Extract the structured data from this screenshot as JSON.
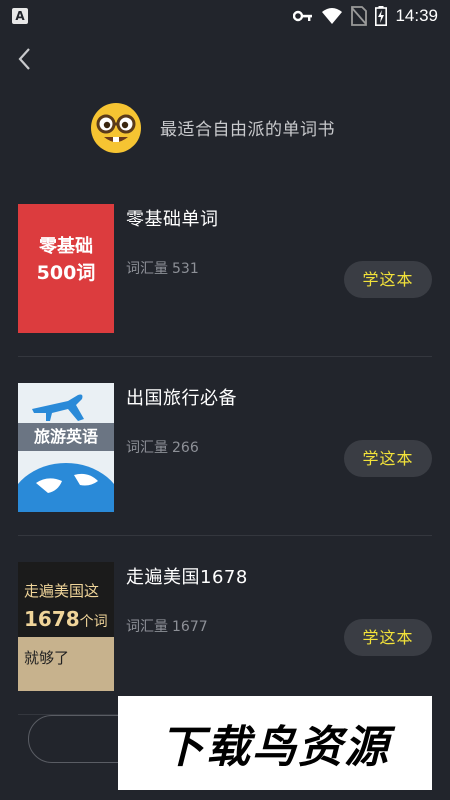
{
  "status_bar": {
    "app_icon_letter": "A",
    "time": "14:39",
    "icons": [
      "key-icon",
      "wifi-icon",
      "no-sim-icon",
      "battery-charging-icon"
    ]
  },
  "header": {
    "back_icon": "chevron-left-icon",
    "emoji": "nerd-face-emoji",
    "tagline": "最适合自由派的单词书"
  },
  "books": [
    {
      "title": "零基础单词",
      "count_label": "词汇量",
      "count": "531",
      "button_label": "学这本",
      "cover": {
        "line1": "零基础",
        "line2": "500词"
      }
    },
    {
      "title": "出国旅行必备",
      "count_label": "词汇量",
      "count": "266",
      "button_label": "学这本",
      "cover": {
        "line1": "旅游英语"
      }
    },
    {
      "title": "走遍美国1678",
      "count_label": "词汇量",
      "count": "1677",
      "button_label": "学这本",
      "cover": {
        "line1": "走遍美国这",
        "line2_num": "1678",
        "line2_unit": "个词",
        "line3": "就够了"
      }
    }
  ],
  "watermark": "下载鸟资源",
  "colors": {
    "background": "#22252c",
    "button_bg": "#3a3d44",
    "button_text": "#f2e23a",
    "muted_text": "#8d9097"
  }
}
